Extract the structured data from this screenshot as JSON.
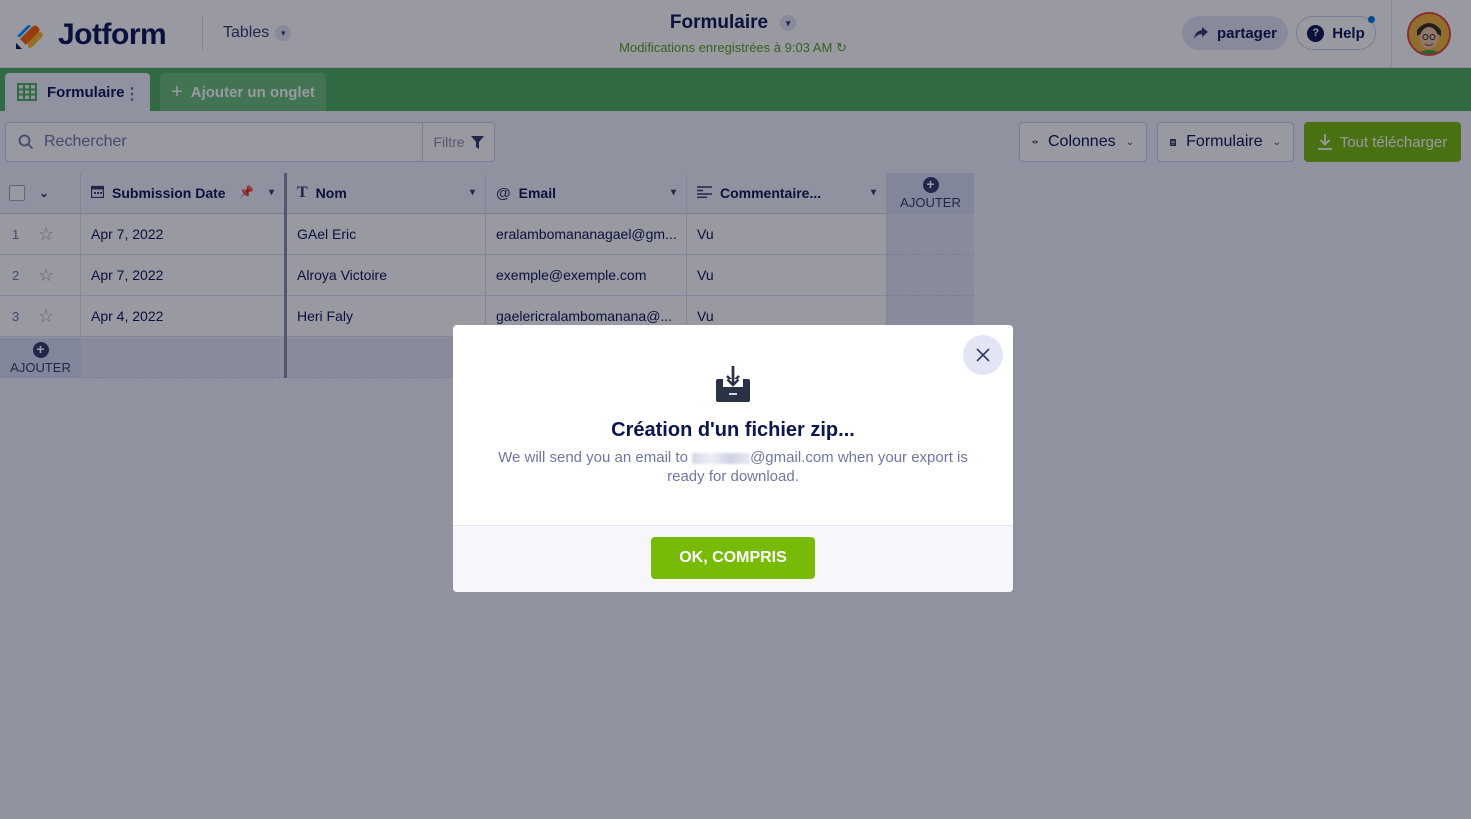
{
  "header": {
    "logo_text": "Jotform",
    "tables_label": "Tables",
    "form_title": "Formulaire",
    "saved_status": "Modifications enregistrées à 9:03 AM",
    "share_label": "partager",
    "help_label": "Help"
  },
  "tabs": {
    "active_label": "Formulaire",
    "add_label": "Ajouter un onglet"
  },
  "toolbar": {
    "search_placeholder": "Rechercher",
    "filter_label": "Filtre",
    "columns_label": "Colonnes",
    "form_label": "Formulaire",
    "download_label": "Tout télécharger"
  },
  "table": {
    "columns": [
      "Submission Date",
      "Nom",
      "Email",
      "Commentaire..."
    ],
    "add_column_label": "AJOUTER",
    "add_row_label": "AJOUTER",
    "rows": [
      {
        "num": "1",
        "date": "Apr 7, 2022",
        "nom": "GAel Eric",
        "email": "eralambomananagael@gm...",
        "comment": "Vu"
      },
      {
        "num": "2",
        "date": "Apr 7, 2022",
        "nom": "Alroya Victoire",
        "email": "exemple@exemple.com",
        "comment": "Vu"
      },
      {
        "num": "3",
        "date": "Apr 4, 2022",
        "nom": "Heri Faly",
        "email": "gaelericralambomanana@...",
        "comment": "Vu"
      }
    ]
  },
  "modal": {
    "title": "Création d'un fichier zip...",
    "text_before": "We will send you an email to ",
    "email_domain": "@gmail.com",
    "text_after": " when your export is ready for download.",
    "ok_label": "OK, COMPRIS"
  },
  "colors": {
    "brand_green": "#4cb05e",
    "action_green": "#78bb07",
    "navy": "#0a1551"
  }
}
